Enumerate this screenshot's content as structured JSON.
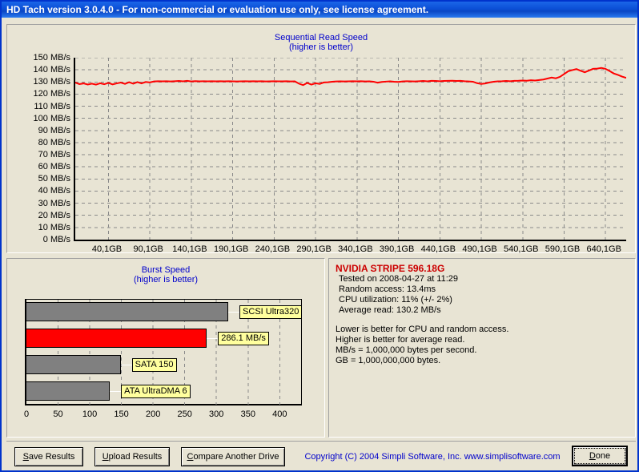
{
  "window": {
    "title": "HD Tach version 3.0.4.0  - For non-commercial or evaluation use only, see license agreement.",
    "accent_color": "#0033cc",
    "background_color": "#e8e4d4"
  },
  "sequential": {
    "title_line1": "Sequential Read Speed",
    "title_line2": "(higher is better)",
    "title_color": "#0000cc"
  },
  "burst": {
    "title_line1": "Burst Speed",
    "title_line2": "(higher is better)",
    "title_color": "#0000cc"
  },
  "info": {
    "drive_name": "NVIDIA STRIPE 596.18G",
    "drive_name_color": "#cc0000",
    "tested_on": "Tested on 2008-04-27 at 11:29",
    "random_access": "Random access: 13.4ms",
    "cpu_utilization": "CPU utilization: 11% (+/- 2%)",
    "average_read": "Average read: 130.2 MB/s",
    "note1": "Lower is better for CPU and random access.",
    "note2": "Higher is better for average read.",
    "note3": "MB/s = 1,000,000 bytes per second.",
    "note4": "GB = 1,000,000,000 bytes."
  },
  "buttons": {
    "save": "Save Results",
    "save_accel": "S",
    "save_rest": "ave Results",
    "upload": "Upload Results",
    "upload_accel": "U",
    "upload_rest": "pload Results",
    "compare": "Compare Another Drive",
    "compare_accel": "C",
    "compare_rest": "ompare Another Drive",
    "done": "Done",
    "done_accel": "D",
    "done_rest": "one"
  },
  "copyright": "Copyright (C) 2004 Simpli Software, Inc. www.simplisoftware.com",
  "chart_data": [
    {
      "type": "line",
      "title": "Sequential Read Speed",
      "subtitle": "(higher is better)",
      "xlabel": "",
      "ylabel": "",
      "grid": true,
      "line_color": "#ff0000",
      "ylim": [
        0,
        150
      ],
      "xlim": [
        0,
        665
      ],
      "ytick_labels": [
        "0 MB/s",
        "10 MB/s",
        "20 MB/s",
        "30 MB/s",
        "40 MB/s",
        "50 MB/s",
        "60 MB/s",
        "70 MB/s",
        "80 MB/s",
        "90 MB/s",
        "100 MB/s",
        "110 MB/s",
        "120 MB/s",
        "130 MB/s",
        "140 MB/s",
        "150 MB/s"
      ],
      "ytick_values": [
        0,
        10,
        20,
        30,
        40,
        50,
        60,
        70,
        80,
        90,
        100,
        110,
        120,
        130,
        140,
        150
      ],
      "xtick_labels": [
        "40,1GB",
        "90,1GB",
        "140,1GB",
        "190,1GB",
        "240,1GB",
        "290,1GB",
        "340,1GB",
        "390,1GB",
        "440,1GB",
        "490,1GB",
        "540,1GB",
        "590,1GB",
        "640,1GB"
      ],
      "xtick_values": [
        40.1,
        90.1,
        140.1,
        190.1,
        240.1,
        290.1,
        340.1,
        390.1,
        440.1,
        490.1,
        540.1,
        590.1,
        640.1
      ],
      "x": [
        0,
        5,
        10,
        15,
        20,
        25,
        30,
        35,
        40,
        45,
        50,
        55,
        60,
        65,
        70,
        75,
        80,
        85,
        90,
        95,
        100,
        105,
        110,
        115,
        120,
        125,
        130,
        135,
        140,
        145,
        150,
        155,
        160,
        165,
        170,
        175,
        180,
        185,
        190,
        195,
        200,
        205,
        210,
        215,
        220,
        225,
        230,
        235,
        240,
        245,
        250,
        255,
        260,
        265,
        270,
        275,
        280,
        285,
        290,
        295,
        300,
        305,
        310,
        315,
        320,
        325,
        330,
        335,
        340,
        345,
        350,
        355,
        360,
        365,
        370,
        375,
        380,
        385,
        390,
        395,
        400,
        405,
        410,
        415,
        420,
        425,
        430,
        435,
        440,
        445,
        450,
        455,
        460,
        465,
        470,
        475,
        480,
        485,
        490,
        495,
        500,
        505,
        510,
        515,
        520,
        525,
        530,
        535,
        540,
        545,
        550,
        555,
        560,
        565,
        570,
        575,
        580,
        585,
        590,
        595,
        600,
        605,
        610,
        615,
        620,
        625,
        630,
        635,
        640,
        645,
        650,
        655,
        660,
        665
      ],
      "y": [
        129.5,
        128.2,
        128.8,
        127.9,
        128.6,
        127.8,
        128.9,
        128.1,
        129.2,
        128.0,
        128.8,
        129.5,
        128.4,
        129.8,
        128.6,
        129.9,
        128.8,
        130.0,
        129.6,
        130.4,
        130.6,
        130.5,
        130.6,
        130.4,
        130.6,
        130.8,
        130.5,
        130.9,
        130.4,
        130.7,
        130.5,
        130.6,
        130.5,
        130.6,
        130.5,
        130.6,
        130.5,
        130.6,
        130.5,
        130.4,
        130.5,
        130.6,
        130.5,
        130.6,
        130.5,
        130.6,
        130.4,
        130.5,
        130.6,
        130.5,
        130.5,
        130.6,
        130.4,
        130.5,
        128.6,
        127.4,
        129.2,
        127.8,
        128.9,
        128.4,
        129.6,
        129.8,
        130.2,
        130.4,
        130.5,
        130.4,
        130.5,
        130.6,
        130.5,
        130.6,
        130.4,
        130.5,
        130.2,
        129.4,
        130.0,
        130.3,
        130.5,
        130.2,
        130.0,
        130.4,
        130.6,
        130.5,
        130.4,
        130.6,
        130.8,
        130.5,
        130.9,
        130.8,
        130.6,
        130.8,
        130.9,
        131.0,
        130.8,
        130.9,
        130.6,
        130.4,
        130.2,
        129.0,
        128.4,
        128.8,
        129.6,
        130.2,
        130.5,
        130.6,
        130.8,
        130.6,
        130.9,
        131.0,
        131.2,
        131.0,
        131.4,
        131.2,
        131.6,
        132.0,
        132.8,
        133.6,
        133.0,
        134.2,
        136.5,
        138.8,
        139.8,
        140.6,
        139.2,
        138.0,
        139.4,
        140.8,
        141.0,
        141.6,
        140.8,
        139.0,
        137.0,
        135.8,
        134.4,
        133.4,
        132.0,
        131.6,
        130.0,
        128.6,
        129.0,
        127.4,
        126.6,
        125.0,
        124.0,
        122.8,
        121.6
      ]
    },
    {
      "type": "bar",
      "orientation": "horizontal",
      "title": "Burst Speed",
      "subtitle": "(higher is better)",
      "categories": [
        "SCSI Ultra320",
        "286.1 MB/s",
        "SATA 150",
        "ATA UltraDMA 6"
      ],
      "values": [
        320,
        286.1,
        150,
        133
      ],
      "bar_colors": [
        "#808080",
        "#ff0000",
        "#808080",
        "#808080"
      ],
      "highlight_index": 1,
      "xlim": [
        0,
        435
      ],
      "xtick_values": [
        0,
        50,
        100,
        150,
        200,
        250,
        300,
        350,
        400
      ],
      "xtick_labels": [
        "0",
        "50",
        "100",
        "150",
        "200",
        "250",
        "300",
        "350",
        "400"
      ],
      "grid": true,
      "xlabel": "",
      "ylabel": ""
    }
  ]
}
